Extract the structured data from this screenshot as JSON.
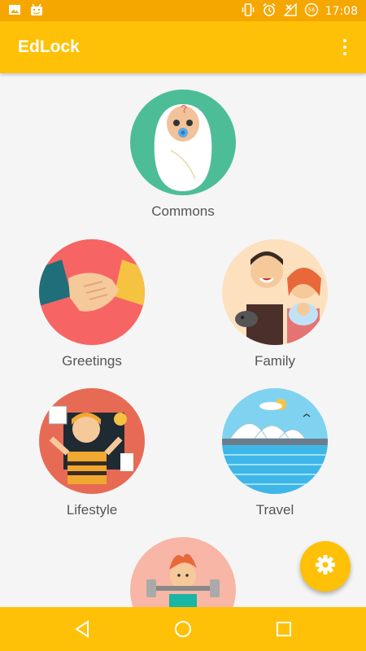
{
  "status_bar": {
    "time": "17:08",
    "icons": [
      "image-icon",
      "android-icon",
      "vibrate-icon",
      "alarm-icon",
      "no-signal-icon",
      "battery-saver-icon"
    ],
    "battery_level": "56"
  },
  "app_bar": {
    "title": "EdLock",
    "menu_icon": "more-vert-icon"
  },
  "categories": [
    {
      "label": "Commons",
      "icon": "baby-icon"
    },
    {
      "label": "Greetings",
      "icon": "handshake-icon"
    },
    {
      "label": "Family",
      "icon": "family-icon"
    },
    {
      "label": "Lifestyle",
      "icon": "lifestyle-icon"
    },
    {
      "label": "Travel",
      "icon": "sydney-opera-icon"
    },
    {
      "label": "",
      "icon": "fitness-icon"
    }
  ],
  "fab": {
    "icon": "settings-gear-icon"
  },
  "nav_bar": {
    "icons": [
      "back-icon",
      "home-icon",
      "recents-icon"
    ]
  },
  "colors": {
    "status_bar": "#f5a700",
    "app_bar": "#ffc107",
    "background": "#f5f5f5",
    "label_text": "#555555"
  }
}
